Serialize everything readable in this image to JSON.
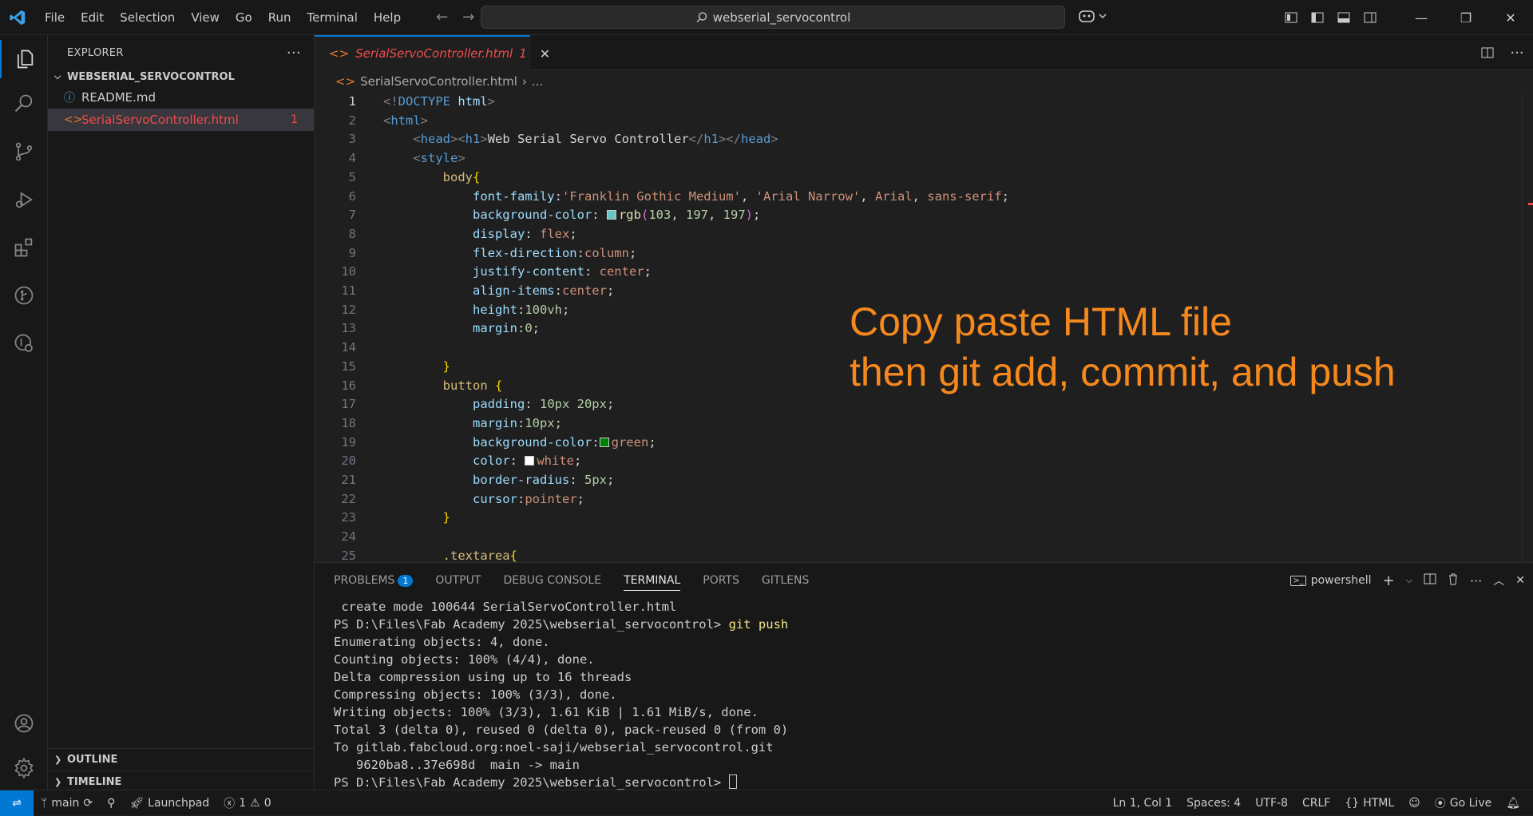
{
  "titlebar": {
    "menu": [
      "File",
      "Edit",
      "Selection",
      "View",
      "Go",
      "Run",
      "Terminal",
      "Help"
    ],
    "search": "webserial_servocontrol"
  },
  "sidebar": {
    "title": "EXPLORER",
    "folder": "WEBSERIAL_SERVOCONTROL",
    "files": [
      {
        "name": "README.md",
        "icon": "info-icon"
      },
      {
        "name": "SerialServoController.html",
        "icon": "html-icon",
        "problems": "1"
      }
    ],
    "outline": "OUTLINE",
    "timeline": "TIMELINE"
  },
  "editor": {
    "tab_label": "SerialServoController.html",
    "tab_problems": "1",
    "breadcrumb_file": "SerialServoController.html",
    "breadcrumb_more": "...",
    "lines": [
      {
        "no": "1",
        "text": "<!DOCTYPE html>"
      },
      {
        "no": "2",
        "text": "<html>"
      },
      {
        "no": "3",
        "text": "    <head><h1>Web Serial Servo Controller</h1></head>"
      },
      {
        "no": "4",
        "text": "    <style>"
      },
      {
        "no": "5",
        "text": "        body{"
      },
      {
        "no": "6",
        "text": "            font-family:'Franklin Gothic Medium', 'Arial Narrow', Arial, sans-serif;"
      },
      {
        "no": "7",
        "text": "            background-color: rgb(103, 197, 197);"
      },
      {
        "no": "8",
        "text": "            display: flex;"
      },
      {
        "no": "9",
        "text": "            flex-direction:column;"
      },
      {
        "no": "10",
        "text": "            justify-content: center;"
      },
      {
        "no": "11",
        "text": "            align-items:center;"
      },
      {
        "no": "12",
        "text": "            height:100vh;"
      },
      {
        "no": "13",
        "text": "            margin:0;"
      },
      {
        "no": "14",
        "text": ""
      },
      {
        "no": "15",
        "text": "        }"
      },
      {
        "no": "16",
        "text": "        button {"
      },
      {
        "no": "17",
        "text": "            padding: 10px 20px;"
      },
      {
        "no": "18",
        "text": "            margin:10px;"
      },
      {
        "no": "19",
        "text": "            background-color:green;"
      },
      {
        "no": "20",
        "text": "            color: white;"
      },
      {
        "no": "21",
        "text": "            border-radius: 5px;"
      },
      {
        "no": "22",
        "text": "            cursor:pointer;"
      },
      {
        "no": "23",
        "text": "        }"
      },
      {
        "no": "24",
        "text": ""
      },
      {
        "no": "25",
        "text": "        .textarea{"
      }
    ],
    "overlay_line1": "Copy paste HTML file",
    "overlay_line2": "then git add, commit, and push"
  },
  "panel": {
    "tabs": [
      "PROBLEMS",
      "OUTPUT",
      "DEBUG CONSOLE",
      "TERMINAL",
      "PORTS",
      "GITLENS"
    ],
    "problems_count": "1",
    "active_tab": "TERMINAL",
    "shell": "powershell",
    "terminal_lines": [
      " create mode 100644 SerialServoController.html",
      "PS D:\\Files\\Fab Academy 2025\\webserial_servocontrol> ",
      "Enumerating objects: 4, done.",
      "Counting objects: 100% (4/4), done.",
      "Delta compression using up to 16 threads",
      "Compressing objects: 100% (3/3), done.",
      "Writing objects: 100% (3/3), 1.61 KiB | 1.61 MiB/s, done.",
      "Total 3 (delta 0), reused 0 (delta 0), pack-reused 0 (from 0)",
      "To gitlab.fabcloud.org:noel-saji/webserial_servocontrol.git",
      "   9620ba8..37e698d  main -> main",
      "PS D:\\Files\\Fab Academy 2025\\webserial_servocontrol> "
    ],
    "push_command": "git push"
  },
  "status": {
    "branch": "main",
    "launchpad": "Launchpad",
    "errors": "1",
    "warnings": "0",
    "position": "Ln 1, Col 1",
    "spaces": "Spaces: 4",
    "encoding": "UTF-8",
    "eol": "CRLF",
    "language": "HTML",
    "golive": "Go Live"
  },
  "colors": {
    "accent": "#0078d4",
    "error": "#f14c4c",
    "overlay": "#f5891e"
  }
}
